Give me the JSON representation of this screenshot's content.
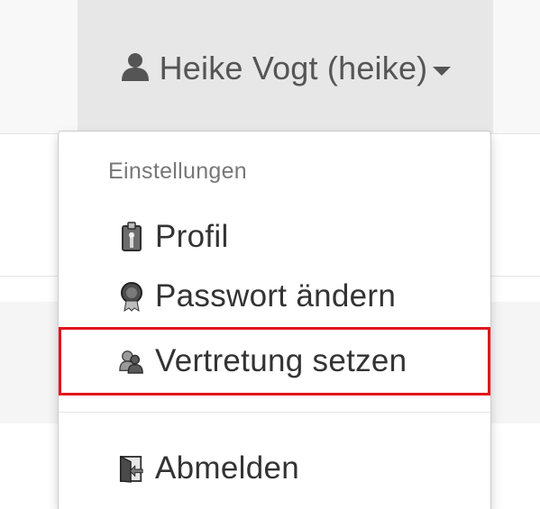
{
  "user_menu": {
    "toggle_label": "Heike Vogt (heike)",
    "toggle_icon": "user-icon",
    "caret_icon": "caret-down-icon"
  },
  "dropdown": {
    "header": "Einstellungen",
    "items": [
      {
        "label": "Profil",
        "icon": "profile-badge-icon"
      },
      {
        "label": "Passwort ändern",
        "icon": "password-seal-icon"
      },
      {
        "label": "Vertretung setzen",
        "icon": "users-lock-icon"
      }
    ],
    "logout": {
      "label": "Abmelden",
      "icon": "logout-icon"
    }
  },
  "highlight_color": "#e0161c"
}
